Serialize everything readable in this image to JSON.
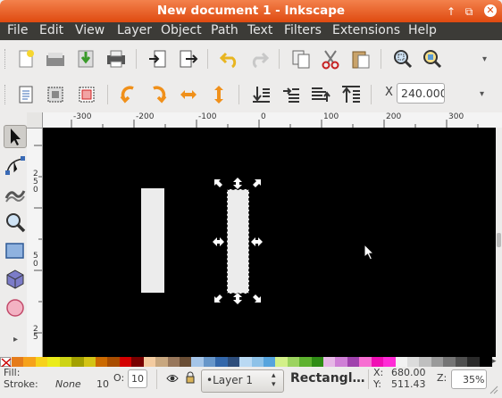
{
  "window": {
    "title": "New document 1 - Inkscape",
    "close_glyph": "✕",
    "up_glyph": "↑",
    "restore_glyph": "⧉"
  },
  "menu": [
    "File",
    "Edit",
    "View",
    "Layer",
    "Object",
    "Path",
    "Text",
    "Filters",
    "Extensions",
    "Help"
  ],
  "toolbar1": {
    "buttons": [
      "new-document-icon",
      "open-icon",
      "import-icon",
      "print-icon",
      "import-bitmap-icon",
      "export-icon",
      "undo-icon",
      "redo-icon",
      "copy-icon",
      "cut-icon",
      "paste-icon",
      "zoom-selection-icon",
      "zoom-drawing-icon"
    ],
    "overflow_glyph": "▾"
  },
  "toolbar2": {
    "buttons": [
      "select-all-icon",
      "select-all-layers-icon",
      "deselect-icon",
      "rotate-ccw-icon",
      "rotate-cw-icon",
      "flip-horizontal-icon",
      "flip-vertical-icon",
      "lower-to-bottom-icon",
      "lower-icon",
      "raise-icon",
      "raise-to-top-icon"
    ],
    "x_label": "X",
    "x_value": "240.000",
    "overflow_glyph": "▾"
  },
  "ruler": {
    "h_labels": [
      "-300",
      "-200",
      "-100",
      "0",
      "100",
      "200",
      "300"
    ],
    "v_labels": [
      "2 5 0",
      "5 0",
      "2 5"
    ]
  },
  "tools": [
    "selector-tool-icon",
    "node-tool-icon",
    "tweak-tool-icon",
    "zoom-tool-icon",
    "rectangle-tool-icon",
    "3d-box-tool-icon",
    "ellipse-tool-icon"
  ],
  "toolbox_more_glyph": "▸",
  "palette": [
    "#e57c1b",
    "#f6a21b",
    "#f7d21b",
    "#ebec1a",
    "#cdd415",
    "#a3a100",
    "#d4c415",
    "#cc6a00",
    "#a94d00",
    "#d40000",
    "#790000",
    "#f3cba0",
    "#c8a77f",
    "#98775b",
    "#6a4e35",
    "#a5c5e8",
    "#6796c9",
    "#3367aa",
    "#2d4d7b",
    "#b9d9f3",
    "#8ec2e8",
    "#56a4dd",
    "#d3f089",
    "#9cd35f",
    "#5eb22f",
    "#2f8c15",
    "#e6b7e6",
    "#cf7fd6",
    "#a042ad",
    "#f76ed2",
    "#f00fb4",
    "#ff2bd6",
    "#f2f2f2",
    "#dcdcdc",
    "#bfbfbf",
    "#9a9a9a",
    "#757575",
    "#4f4f4f",
    "#2a2a2a",
    "#000000"
  ],
  "status": {
    "fill_label": "Fill:",
    "stroke_label": "Stroke:",
    "stroke_value": "None",
    "stroke_width": "10",
    "opacity_label": "O:",
    "opacity_value": "10",
    "layer_value": "•Layer 1",
    "message": "Rectangl…",
    "x_label": "X:",
    "x_value": "680.00",
    "y_label": "Y:",
    "y_value": "511.43",
    "zoom_label": "Z:",
    "zoom_value": "35%"
  }
}
